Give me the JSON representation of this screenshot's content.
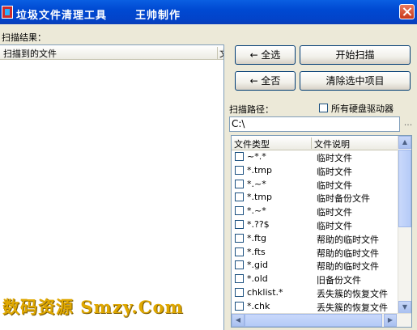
{
  "window": {
    "title": "垃圾文件清理工具",
    "author": "王帅制作"
  },
  "results": {
    "label": "扫描结果：",
    "col_file": "扫描到的文件",
    "col_type": "文"
  },
  "buttons": {
    "select_all": "← 全选",
    "start_scan": "开始扫描",
    "select_none": "← 全否",
    "clear_selected": "清除选中项目"
  },
  "scan_path": {
    "label": "扫描路径：",
    "value": "C:\\",
    "browse": "...",
    "all_drives_label": "所有硬盘驱动器"
  },
  "types": {
    "col_type": "文件类型",
    "col_desc": "文件说明",
    "rows": [
      {
        "pattern": "~*.*",
        "desc": "临时文件"
      },
      {
        "pattern": "*.tmp",
        "desc": "临时文件"
      },
      {
        "pattern": "*.~*",
        "desc": "临时文件"
      },
      {
        "pattern": "*.tmp",
        "desc": "临时备份文件"
      },
      {
        "pattern": "*.~*",
        "desc": "临时文件"
      },
      {
        "pattern": "*.??$",
        "desc": "临时文件"
      },
      {
        "pattern": "*.ftg",
        "desc": "帮助的临时文件"
      },
      {
        "pattern": "*.fts",
        "desc": "帮助的临时文件"
      },
      {
        "pattern": "*.gid",
        "desc": "帮助的临时文件"
      },
      {
        "pattern": "*.old",
        "desc": "旧备份文件"
      },
      {
        "pattern": "chklist.*",
        "desc": "丢失簇的恢复文件"
      },
      {
        "pattern": "*.chk",
        "desc": "丢失簇的恢复文件"
      }
    ]
  },
  "watermark": "数码资源 Smzy.Com"
}
